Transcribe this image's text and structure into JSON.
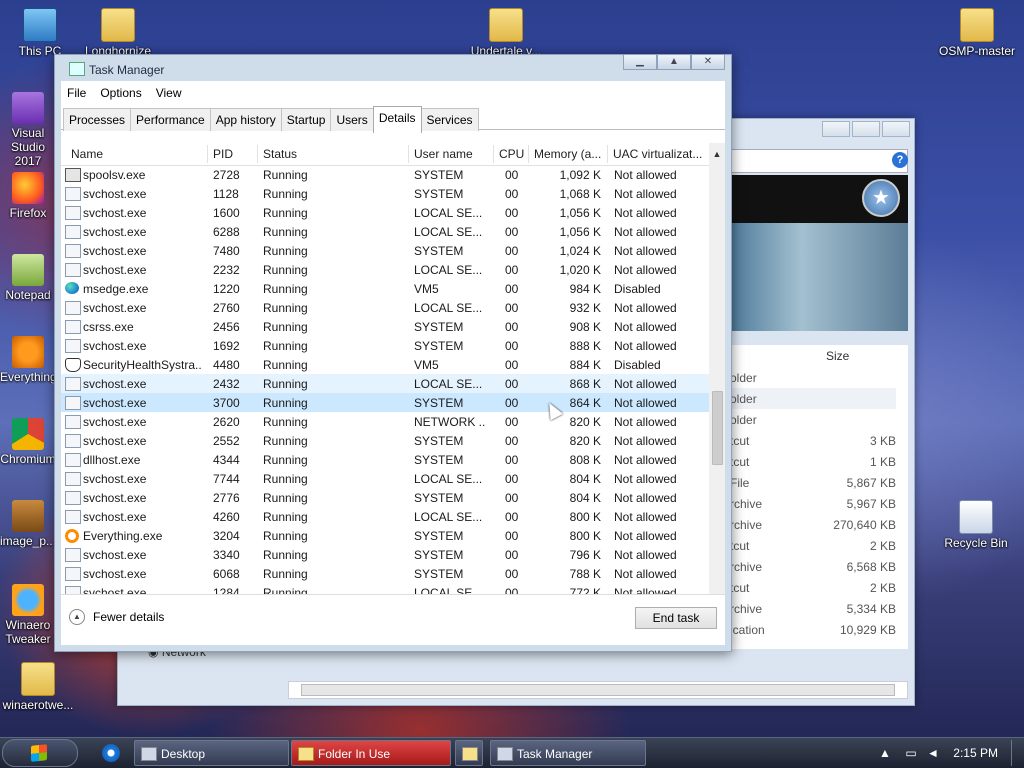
{
  "desktop": {
    "icons": [
      {
        "label": "This PC"
      },
      {
        "label": "Longhornize"
      },
      {
        "label": "Undertale v..."
      },
      {
        "label": "OSMP-master"
      },
      {
        "label": "Visual Studio 2017"
      },
      {
        "label": "Firefox"
      },
      {
        "label": "Notepad"
      },
      {
        "label": "Everything"
      },
      {
        "label": "Chromium"
      },
      {
        "label": "image_p..."
      },
      {
        "label": "Winaero Tweaker"
      },
      {
        "label": "winaerotwe..."
      },
      {
        "label": "Recycle Bin"
      }
    ]
  },
  "explorer": {
    "size_header": "Size",
    "network_label": "Network",
    "files": [
      {
        "type": "older",
        "size": ""
      },
      {
        "type": "older",
        "size": ""
      },
      {
        "type": "older",
        "size": ""
      },
      {
        "type": "tcut",
        "size": "3 KB"
      },
      {
        "type": "tcut",
        "size": "1 KB"
      },
      {
        "type": "File",
        "size": "5,867 KB"
      },
      {
        "type": "rchive",
        "size": "5,967 KB"
      },
      {
        "type": "rchive",
        "size": "270,640 KB"
      },
      {
        "type": "tcut",
        "size": "2 KB"
      },
      {
        "type": "rchive",
        "size": "6,568 KB"
      },
      {
        "type": "tcut",
        "size": "2 KB"
      },
      {
        "type": "rchive",
        "size": "5,334 KB"
      },
      {
        "type": "ication",
        "size": "10,929 KB"
      }
    ]
  },
  "task_manager": {
    "title": "Task Manager",
    "menu": [
      "File",
      "Options",
      "View"
    ],
    "tabs": [
      "Processes",
      "Performance",
      "App history",
      "Startup",
      "Users",
      "Details",
      "Services"
    ],
    "active_tab": "Details",
    "columns": {
      "name": "Name",
      "pid": "PID",
      "status": "Status",
      "user": "User name",
      "cpu": "CPU",
      "memory": "Memory (a...",
      "uac": "UAC virtualizat..."
    },
    "rows": [
      {
        "name": "spoolsv.exe",
        "pid": "2728",
        "status": "Running",
        "user": "SYSTEM",
        "cpu": "00",
        "memory": "1,092 K",
        "uac": "Not allowed",
        "icon": "printer"
      },
      {
        "name": "svchost.exe",
        "pid": "1128",
        "status": "Running",
        "user": "SYSTEM",
        "cpu": "00",
        "memory": "1,068 K",
        "uac": "Not allowed",
        "icon": "generic"
      },
      {
        "name": "svchost.exe",
        "pid": "1600",
        "status": "Running",
        "user": "LOCAL SE...",
        "cpu": "00",
        "memory": "1,056 K",
        "uac": "Not allowed",
        "icon": "generic"
      },
      {
        "name": "svchost.exe",
        "pid": "6288",
        "status": "Running",
        "user": "LOCAL SE...",
        "cpu": "00",
        "memory": "1,056 K",
        "uac": "Not allowed",
        "icon": "generic"
      },
      {
        "name": "svchost.exe",
        "pid": "7480",
        "status": "Running",
        "user": "SYSTEM",
        "cpu": "00",
        "memory": "1,024 K",
        "uac": "Not allowed",
        "icon": "generic"
      },
      {
        "name": "svchost.exe",
        "pid": "2232",
        "status": "Running",
        "user": "LOCAL SE...",
        "cpu": "00",
        "memory": "1,020 K",
        "uac": "Not allowed",
        "icon": "generic"
      },
      {
        "name": "msedge.exe",
        "pid": "1220",
        "status": "Running",
        "user": "VM5",
        "cpu": "00",
        "memory": "984 K",
        "uac": "Disabled",
        "icon": "edge"
      },
      {
        "name": "svchost.exe",
        "pid": "2760",
        "status": "Running",
        "user": "LOCAL SE...",
        "cpu": "00",
        "memory": "932 K",
        "uac": "Not allowed",
        "icon": "generic"
      },
      {
        "name": "csrss.exe",
        "pid": "2456",
        "status": "Running",
        "user": "SYSTEM",
        "cpu": "00",
        "memory": "908 K",
        "uac": "Not allowed",
        "icon": "generic"
      },
      {
        "name": "svchost.exe",
        "pid": "1692",
        "status": "Running",
        "user": "SYSTEM",
        "cpu": "00",
        "memory": "888 K",
        "uac": "Not allowed",
        "icon": "generic"
      },
      {
        "name": "SecurityHealthSystra...",
        "pid": "4480",
        "status": "Running",
        "user": "VM5",
        "cpu": "00",
        "memory": "884 K",
        "uac": "Disabled",
        "icon": "shield"
      },
      {
        "name": "svchost.exe",
        "pid": "2432",
        "status": "Running",
        "user": "LOCAL SE...",
        "cpu": "00",
        "memory": "868 K",
        "uac": "Not allowed",
        "icon": "generic",
        "state": "hover"
      },
      {
        "name": "svchost.exe",
        "pid": "3700",
        "status": "Running",
        "user": "SYSTEM",
        "cpu": "00",
        "memory": "864 K",
        "uac": "Not allowed",
        "icon": "generic",
        "state": "selected"
      },
      {
        "name": "svchost.exe",
        "pid": "2620",
        "status": "Running",
        "user": "NETWORK ...",
        "cpu": "00",
        "memory": "820 K",
        "uac": "Not allowed",
        "icon": "generic"
      },
      {
        "name": "svchost.exe",
        "pid": "2552",
        "status": "Running",
        "user": "SYSTEM",
        "cpu": "00",
        "memory": "820 K",
        "uac": "Not allowed",
        "icon": "generic"
      },
      {
        "name": "dllhost.exe",
        "pid": "4344",
        "status": "Running",
        "user": "SYSTEM",
        "cpu": "00",
        "memory": "808 K",
        "uac": "Not allowed",
        "icon": "generic"
      },
      {
        "name": "svchost.exe",
        "pid": "7744",
        "status": "Running",
        "user": "LOCAL SE...",
        "cpu": "00",
        "memory": "804 K",
        "uac": "Not allowed",
        "icon": "generic"
      },
      {
        "name": "svchost.exe",
        "pid": "2776",
        "status": "Running",
        "user": "SYSTEM",
        "cpu": "00",
        "memory": "804 K",
        "uac": "Not allowed",
        "icon": "generic"
      },
      {
        "name": "svchost.exe",
        "pid": "4260",
        "status": "Running",
        "user": "LOCAL SE...",
        "cpu": "00",
        "memory": "800 K",
        "uac": "Not allowed",
        "icon": "generic"
      },
      {
        "name": "Everything.exe",
        "pid": "3204",
        "status": "Running",
        "user": "SYSTEM",
        "cpu": "00",
        "memory": "800 K",
        "uac": "Not allowed",
        "icon": "search"
      },
      {
        "name": "svchost.exe",
        "pid": "3340",
        "status": "Running",
        "user": "SYSTEM",
        "cpu": "00",
        "memory": "796 K",
        "uac": "Not allowed",
        "icon": "generic"
      },
      {
        "name": "svchost.exe",
        "pid": "6068",
        "status": "Running",
        "user": "SYSTEM",
        "cpu": "00",
        "memory": "788 K",
        "uac": "Not allowed",
        "icon": "generic"
      },
      {
        "name": "svchost.exe",
        "pid": "1284",
        "status": "Running",
        "user": "LOCAL SE...",
        "cpu": "00",
        "memory": "772 K",
        "uac": "Not allowed",
        "icon": "generic"
      }
    ],
    "fewer_details": "Fewer details",
    "end_task": "End task"
  },
  "taskbar": {
    "buttons": [
      {
        "label": "Desktop"
      },
      {
        "label": "Folder In Use"
      },
      {
        "label": "Task Manager"
      }
    ],
    "clock": "2:15 PM"
  }
}
